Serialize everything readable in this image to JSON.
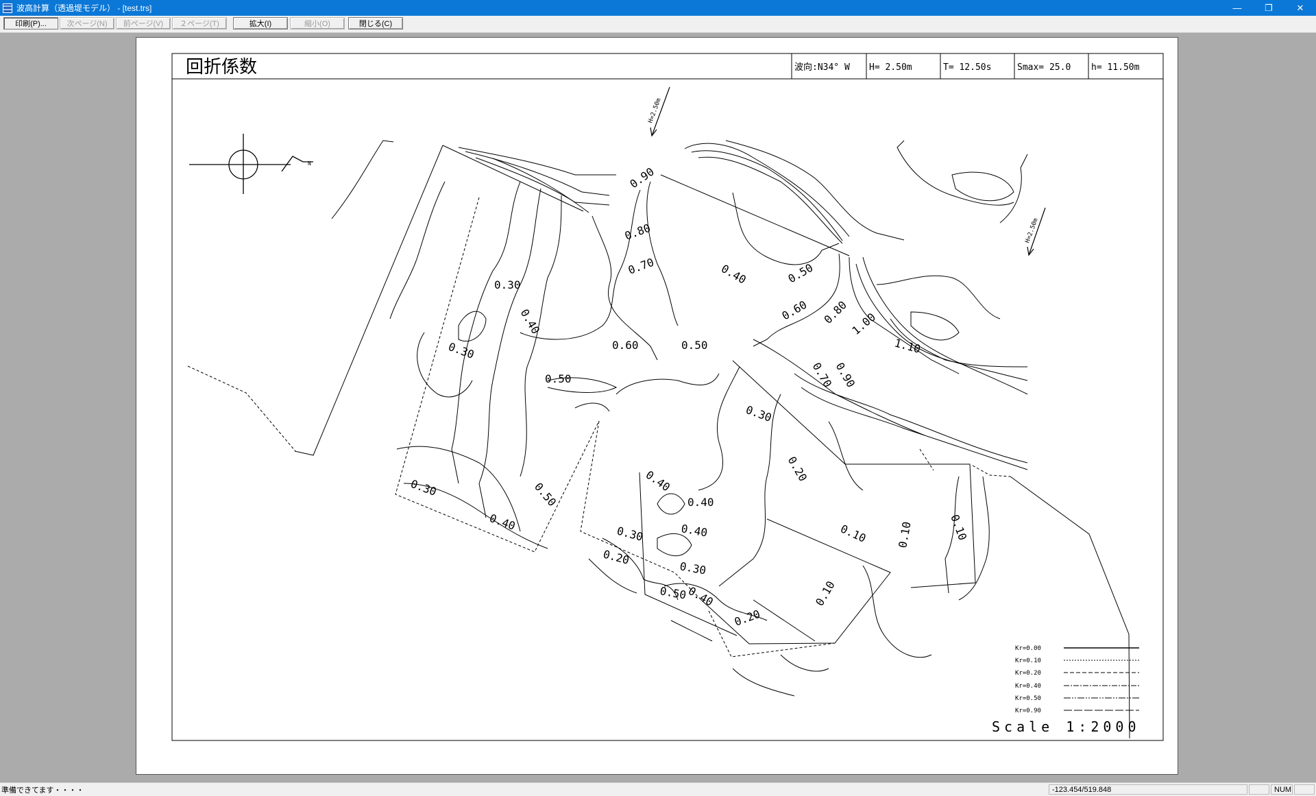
{
  "window": {
    "title": "波高計算（透過堤モデル） - [test.trs]",
    "minimize": "—",
    "restore": "❐",
    "close": "✕"
  },
  "toolbar": [
    "印刷(P)...",
    "次ページ(N)",
    "前ページ(V)",
    "２ページ(T)",
    "拡大(I)",
    "縮小(O)",
    "閉じる(C)"
  ],
  "sheet": {
    "title": "回折係数",
    "params": [
      "波向:N34° W",
      "H= 2.50m",
      "T= 12.50s",
      "Smax= 25.0",
      "h=  11.50m"
    ],
    "wave_label": "H=2.50m",
    "north_letter": "N",
    "scale": "Scale  1:2000",
    "legend": [
      "Kr=0.00",
      "Kr=0.10",
      "Kr=0.20",
      "Kr=0.40",
      "Kr=0.50",
      "Kr=0.90"
    ],
    "contour_labels": [
      "0.90",
      "0.80",
      "0.70",
      "0.40",
      "0.50",
      "0.30",
      "0.40",
      "0.30",
      "0.60",
      "0.50",
      "0.60",
      "0.50",
      "0.80",
      "1.00",
      "1.10",
      "0.70",
      "0.90",
      "0.30",
      "0.20",
      "0.40",
      "0.40",
      "0.40",
      "0.30",
      "0.20",
      "0.30",
      "0.50",
      "0.40",
      "0.20",
      "0.10",
      "0.10",
      "0.10",
      "0.10",
      "0.30",
      "0.40",
      "0.50"
    ]
  },
  "status": {
    "message": "準備できてます・・・・",
    "coords": "-123.454/519.848",
    "num": "NUM"
  }
}
